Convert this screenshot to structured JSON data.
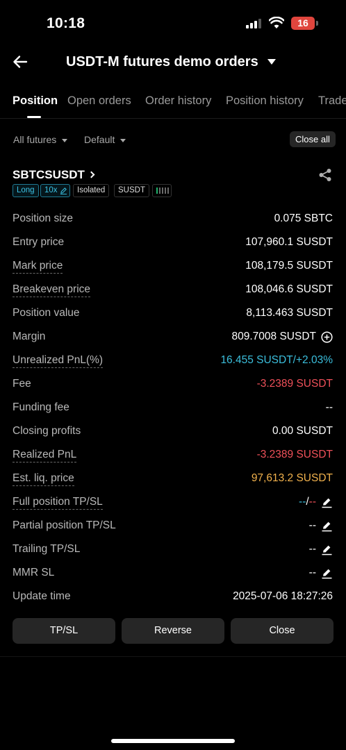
{
  "status_bar": {
    "time": "10:18",
    "battery": "16"
  },
  "header": {
    "title": "USDT-M futures demo orders"
  },
  "tabs": [
    {
      "label": "Position",
      "active": true
    },
    {
      "label": "Open orders"
    },
    {
      "label": "Order history"
    },
    {
      "label": "Position history"
    },
    {
      "label": "Trade"
    }
  ],
  "filters": {
    "market": "All futures",
    "sort": "Default",
    "close_all": "Close all"
  },
  "position": {
    "symbol": "SBTCSUSDT",
    "tags": {
      "side": "Long",
      "leverage": "10x",
      "margin_mode": "Isolated",
      "coin": "SUSDT"
    },
    "rows": {
      "position_size": {
        "label": "Position size",
        "value": "0.075 SBTC"
      },
      "entry_price": {
        "label": "Entry price",
        "value": "107,960.1 SUSDT"
      },
      "mark_price": {
        "label": "Mark price",
        "value": "108,179.5 SUSDT"
      },
      "breakeven_price": {
        "label": "Breakeven price",
        "value": "108,046.6 SUSDT"
      },
      "position_value": {
        "label": "Position value",
        "value": "8,113.463 SUSDT"
      },
      "margin": {
        "label": "Margin",
        "value": "809.7008 SUSDT"
      },
      "unrealized_pnl": {
        "label": "Unrealized PnL(%)",
        "value": "16.455 SUSDT/+2.03%"
      },
      "fee": {
        "label": "Fee",
        "value": "-3.2389 SUSDT"
      },
      "funding_fee": {
        "label": "Funding fee",
        "value": "--"
      },
      "closing_profits": {
        "label": "Closing profits",
        "value": "0.00 SUSDT"
      },
      "realized_pnl": {
        "label": "Realized PnL",
        "value": "-3.2389 SUSDT"
      },
      "est_liq_price": {
        "label": "Est. liq. price",
        "value": "97,613.2 SUSDT"
      },
      "full_tpsl": {
        "label": "Full position TP/SL",
        "tp": "--",
        "sep": "/",
        "sl": "--"
      },
      "partial_tpsl": {
        "label": "Partial position TP/SL",
        "value": "--"
      },
      "trailing_tpsl": {
        "label": "Trailing TP/SL",
        "value": "--"
      },
      "mmr_sl": {
        "label": "MMR SL",
        "value": "--"
      },
      "update_time": {
        "label": "Update time",
        "value": "2025-07-06 18:27:26"
      }
    }
  },
  "actions": {
    "tpsl": "TP/SL",
    "reverse": "Reverse",
    "close": "Close"
  },
  "colors": {
    "positive": "#3bbfdd",
    "negative": "#f0515a",
    "liquidation": "#f2b24d",
    "background": "#000000"
  }
}
